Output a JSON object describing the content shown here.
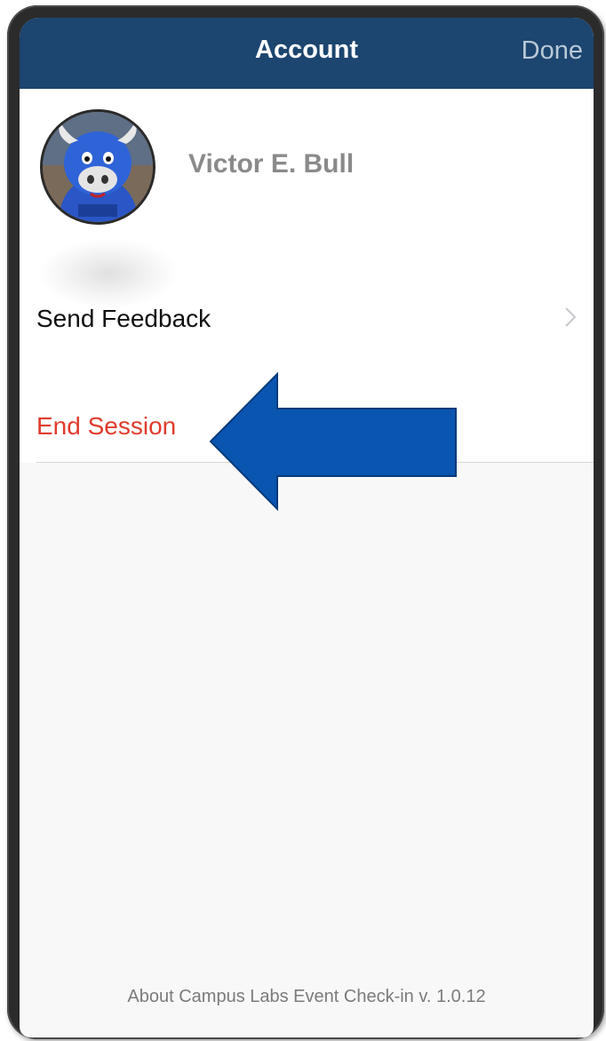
{
  "header": {
    "title": "Account",
    "done_label": "Done"
  },
  "profile": {
    "name": "Victor E. Bull",
    "avatar_icon": "mascot-avatar-icon"
  },
  "menu": {
    "send_feedback": "Send Feedback",
    "end_session": "End Session"
  },
  "footer": {
    "about": "About Campus Labs Event Check-in v. 1.0.12"
  },
  "colors": {
    "nav_bar": "#1c456f",
    "nav_title": "#ffffff",
    "done": "#b9c8d8",
    "end_session": "#e03b2c",
    "annotation_arrow": "#0a55b0",
    "background": "#f8f8f8"
  }
}
